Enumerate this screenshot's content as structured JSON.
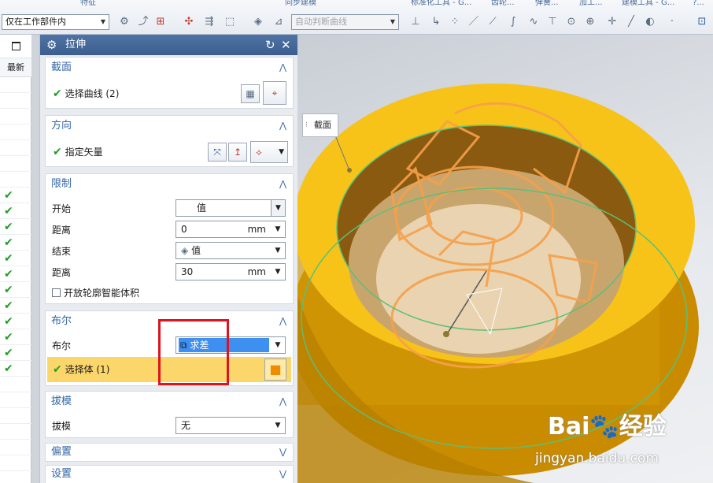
{
  "toolbar": {
    "groups": [
      "特征",
      "同步建模",
      "标准化工具 - G...",
      "齿轮...",
      "弹簧...",
      "加工...",
      "建模工具 - G...",
      "?..."
    ],
    "filter_select": "仅在工作部件内",
    "curve_rule_select": "自动判断曲线"
  },
  "left_strip": {
    "header": "最新",
    "check_mark": "✔"
  },
  "dialog": {
    "title": "拉伸",
    "section_profile": {
      "title": "截面",
      "select_curve": "选择曲线 (2)"
    },
    "section_direction": {
      "title": "方向",
      "specify_vector": "指定矢量"
    },
    "section_limits": {
      "title": "限制",
      "start_label": "开始",
      "start_value": "值",
      "distance1_label": "距离",
      "distance1_value": "0",
      "distance1_unit": "mm",
      "end_label": "结束",
      "end_value": "值",
      "distance2_label": "距离",
      "distance2_value": "30",
      "distance2_unit": "mm",
      "open_profile": "开放轮廓智能体积"
    },
    "section_boolean": {
      "title": "布尔",
      "boolean_label": "布尔",
      "boolean_value": "求差",
      "select_body": "选择体 (1)"
    },
    "section_draft": {
      "title": "拔模",
      "draft_label": "拔模",
      "draft_value": "无"
    },
    "section_offset": {
      "title": "偏置"
    },
    "section_settings": {
      "title": "设置"
    }
  },
  "viewport": {
    "callout": "截面",
    "watermark_main": "Bai🐾经验",
    "watermark_url": "jingyan.baidu.com"
  },
  "colors": {
    "accent": "#3b5e8e",
    "section_title": "#3567a6",
    "boolean_highlight": "#3d8ff0",
    "selected_row": "#fbd66b",
    "solid_yellow": "#f2b705",
    "annotation_red": "#e0121e"
  }
}
